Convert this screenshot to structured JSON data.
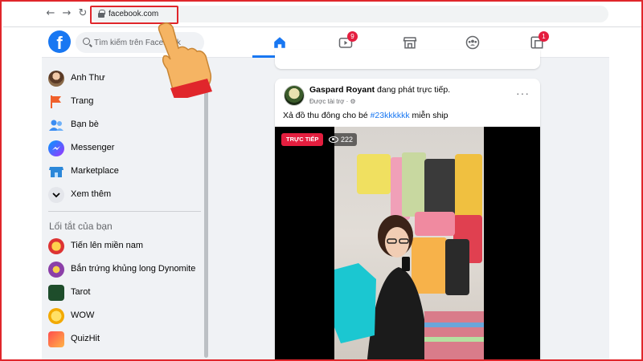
{
  "browser": {
    "url": "facebook.com",
    "back_icon": "arrow-left-icon",
    "forward_icon": "arrow-right-icon",
    "reload_icon": "reload-icon",
    "highlight_color": "#e0262b"
  },
  "header": {
    "logo_letter": "f",
    "search_placeholder": "Tìm kiếm trên Facebook",
    "tabs": [
      {
        "name": "home",
        "icon": "home-icon",
        "active": true,
        "badge": ""
      },
      {
        "name": "watch",
        "icon": "video-icon",
        "active": false,
        "badge": "9"
      },
      {
        "name": "marketplace",
        "icon": "shop-icon",
        "active": false,
        "badge": ""
      },
      {
        "name": "groups",
        "icon": "groups-icon",
        "active": false,
        "badge": ""
      },
      {
        "name": "gaming",
        "icon": "gaming-icon",
        "active": false,
        "badge": "1"
      }
    ],
    "accent_color": "#1877f2",
    "badge_color": "#e41e3f"
  },
  "sidebar": {
    "items": [
      {
        "label": "Anh Thư",
        "icon": "profile-avatar"
      },
      {
        "label": "Trang",
        "icon": "flag-icon"
      },
      {
        "label": "Bạn bè",
        "icon": "friends-icon"
      },
      {
        "label": "Messenger",
        "icon": "messenger-icon"
      },
      {
        "label": "Marketplace",
        "icon": "shop-icon"
      },
      {
        "label": "Xem thêm",
        "icon": "chevron-down-icon"
      }
    ],
    "section_title": "Lối tắt của bạn",
    "shortcuts": [
      {
        "label": "Tiến lên miền nam",
        "icon": "game-cards-icon"
      },
      {
        "label": "Bắn trứng khủng long Dynomite",
        "icon": "game-dino-icon"
      },
      {
        "label": "Tarot",
        "icon": "tarot-icon"
      },
      {
        "label": "WOW",
        "icon": "wow-icon"
      },
      {
        "label": "QuizHit",
        "icon": "quizhit-icon"
      }
    ]
  },
  "post": {
    "author": "Gaspard Royant",
    "action": " đang phát trực tiếp.",
    "sponsored": "Được tài trợ · ",
    "caption_prefix": "Xả đồ thu đông cho bé ",
    "hashtag": "#23kkkkkk",
    "caption_suffix": " miễn ship",
    "live_label": "TRỰC TIẾP",
    "view_count": "222",
    "more_icon": "more-horizontal-icon"
  }
}
